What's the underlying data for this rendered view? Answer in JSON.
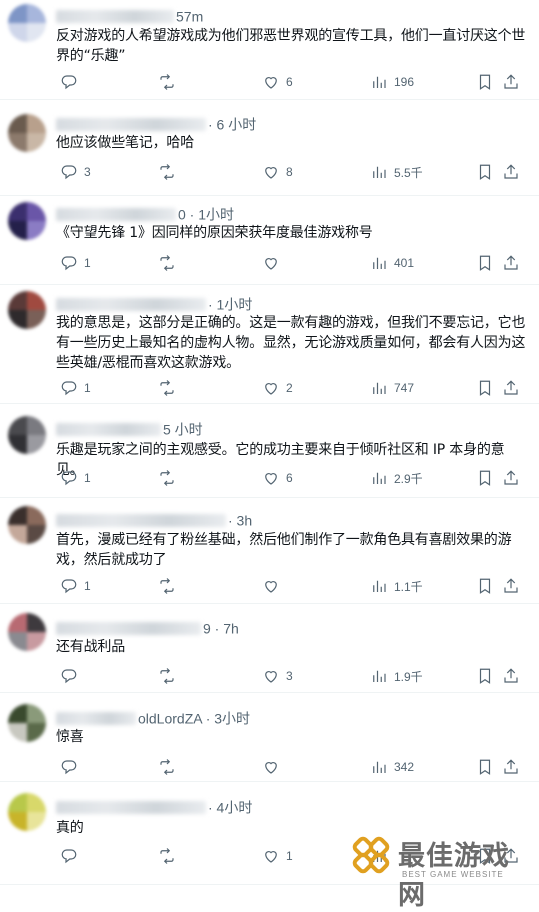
{
  "tweets": [
    {
      "time": "57m",
      "text": "反对游戏的人希望游戏成为他们邪恶世界观的宣传工具，他们一直讨厌这个世界的“乐趣”",
      "replies": "",
      "retweets": "",
      "likes": "6",
      "views": "196",
      "avatar": [
        "#7e95c6",
        "#a7b6dc",
        "#cfd6ea",
        "#e1e6f1"
      ]
    },
    {
      "time": "· 6 小时",
      "text": "他应该做些笔记，哈哈",
      "replies": "3",
      "retweets": "",
      "likes": "8",
      "views": "5.5千",
      "avatar": [
        "#6a5b4e",
        "#b8a08c",
        "#8c7a6c",
        "#c9b7a6"
      ]
    },
    {
      "time": "0 · 1小时",
      "text": "《守望先锋 1》因同样的原因荣获年度最佳游戏称号",
      "replies": "1",
      "retweets": "",
      "likes": "",
      "views": "401",
      "avatar": [
        "#3b2f6e",
        "#6a56a8",
        "#24204a",
        "#8b7cc4"
      ]
    },
    {
      "time": "· 1小时",
      "text": "我的意思是，这部分是正确的。这是一款有趣的游戏，但我们不要忘记，它也有一些历史上最知名的虚构人物。显然，无论游戏质量如何，都会有人因为这些英雄/恶棍而喜欢这款游戏。",
      "replies": "1",
      "retweets": "",
      "likes": "2",
      "views": "747",
      "avatar": [
        "#5a3a38",
        "#a04a40",
        "#2e2a2c",
        "#7a6058"
      ]
    },
    {
      "time": "5 小时",
      "text": "乐趣是玩家之间的主观感受。它的成功主要来自于倾听社区和 IP 本身的意见。",
      "replies": "1",
      "retweets": "",
      "likes": "6",
      "views": "2.9千",
      "avatar": [
        "#4a4a4e",
        "#7a7a80",
        "#303034",
        "#9a9aa0"
      ]
    },
    {
      "time": "· 3h",
      "text": "首先，漫威已经有了粉丝基础，然后他们制作了一款角色具有喜剧效果的游戏，然后就成功了",
      "replies": "1",
      "retweets": "",
      "likes": "",
      "views": "1.1千",
      "avatar": [
        "#3a2f2c",
        "#8a6a5c",
        "#c4a89a",
        "#5a4a44"
      ]
    },
    {
      "time": "9 · 7h",
      "text": "还有战利品",
      "replies": "",
      "retweets": "",
      "likes": "3",
      "views": "1.9千",
      "avatar": [
        "#b86a72",
        "#3e3a3e",
        "#8a8a90",
        "#c89aa0"
      ]
    },
    {
      "time": "oldLordZA · 3小时",
      "text": "惊喜",
      "replies": "",
      "retweets": "",
      "likes": "",
      "views": "342",
      "avatar": [
        "#3a4a2e",
        "#8a9a7a",
        "#c8c8c0",
        "#5a6a4a"
      ]
    },
    {
      "time": "· 4小时",
      "text": "真的",
      "replies": "",
      "retweets": "",
      "likes": "1",
      "views": "",
      "avatar": [
        "#b8c84a",
        "#d8d86a",
        "#c8b42a",
        "#e8e49a"
      ]
    }
  ],
  "watermark": {
    "title": "最佳游戏网",
    "subtitle": "BEST GAME WEBSITE"
  },
  "icons": {
    "reply": "reply-icon",
    "retweet": "retweet-icon",
    "like": "heart-icon",
    "views": "views-icon",
    "bookmark": "bookmark-icon",
    "share": "share-icon"
  }
}
